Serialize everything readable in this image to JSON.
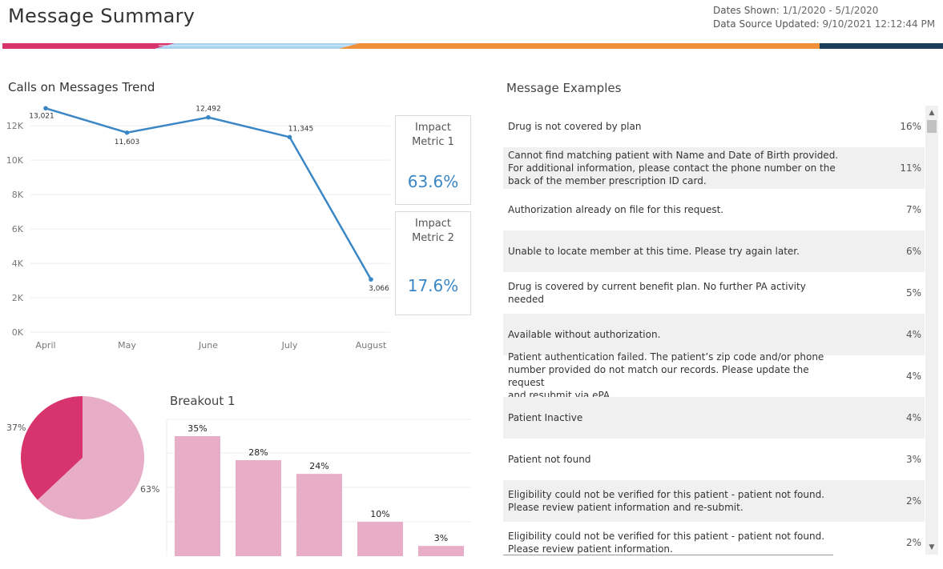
{
  "header": {
    "title": "Message Summary",
    "dates_label": "Dates Shown:",
    "dates_value": "1/1/2020 - 5/1/2020",
    "updated_label": "Data Source Updated:",
    "updated_value": "9/10/2021 12:12:44 PM"
  },
  "colors": {
    "pink_dark": "#d7336c",
    "pink_light": "#e8adc7",
    "blue_line": "#3b87c6",
    "orange": "#f0913a",
    "navy": "#1d3d5c"
  },
  "metrics": [
    {
      "label_line1": "Impact",
      "label_line2": "Metric 1",
      "value": "63.6%"
    },
    {
      "label_line1": "Impact",
      "label_line2": "Metric 2",
      "value": "17.6%"
    }
  ],
  "examples": {
    "title": "Message Examples",
    "rows": [
      {
        "text": "Drug is not covered by plan",
        "pct": "16%"
      },
      {
        "text": "Cannot find matching patient with Name and Date of Birth provided.\nFor additional information, please contact the phone number on the\nback of the member prescription ID card.",
        "pct": "11%"
      },
      {
        "text": "Authorization already on file for this request.",
        "pct": "7%"
      },
      {
        "text": "Unable to locate member at this time. Please try again later.",
        "pct": "6%"
      },
      {
        "text": "Drug is covered by current benefit plan. No further PA activity needed",
        "pct": "5%"
      },
      {
        "text": "Available without authorization.",
        "pct": "4%"
      },
      {
        "text": "Patient authentication failed.  The patient’s zip code and/or phone\nnumber provided do not match our records.  Please update the request\nand resubmit via ePA.",
        "pct": "4%"
      },
      {
        "text": "Patient Inactive",
        "pct": "4%"
      },
      {
        "text": "Patient not found",
        "pct": "3%"
      },
      {
        "text": "Eligibility could not be verified for this patient - patient not found.\nPlease review patient information and re-submit.",
        "pct": "2%"
      },
      {
        "text": "Eligibility could not be verified for this patient - patient not found.\nPlease review patient information.",
        "pct": "2%"
      }
    ]
  },
  "chart_data": [
    {
      "type": "line",
      "title": "Calls on Messages Trend",
      "categories": [
        "April",
        "May",
        "June",
        "July",
        "August"
      ],
      "values": [
        13021,
        11603,
        12492,
        11345,
        3066
      ],
      "data_labels": [
        "13,021",
        "11,603",
        "12,492",
        "11,345",
        "3,066"
      ],
      "yticks": [
        "0K",
        "2K",
        "4K",
        "6K",
        "8K",
        "10K",
        "12K"
      ],
      "ylim": [
        0,
        13500
      ],
      "grid": true,
      "color": "#3b87c6"
    },
    {
      "type": "pie",
      "values": [
        37,
        63
      ],
      "labels": [
        "37%",
        "63%"
      ],
      "colors": [
        "#d7336c",
        "#e8adc7"
      ]
    },
    {
      "type": "bar",
      "title": "Breakout 1",
      "values": [
        35,
        28,
        24,
        10,
        3
      ],
      "data_labels": [
        "35%",
        "28%",
        "24%",
        "10%",
        "3%"
      ],
      "ylim": [
        0,
        40
      ],
      "color": "#e8adc7"
    }
  ]
}
